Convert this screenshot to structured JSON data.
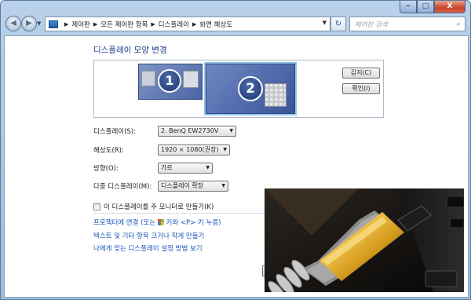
{
  "window": {
    "caption": {
      "minimize": "–",
      "maximize": "□",
      "close": "X"
    }
  },
  "nav": {
    "back_icon": "back-arrow-icon",
    "forward_icon": "forward-arrow-icon",
    "breadcrumbs": [
      "제어판",
      "모든 제어판 항목",
      "디스플레이",
      "화면 해상도"
    ],
    "refresh_icon": "refresh-icon",
    "search_placeholder": "제어판 검색"
  },
  "page": {
    "title": "디스플레이 모양 변경",
    "monitors": [
      {
        "number": "1",
        "selected": false
      },
      {
        "number": "2",
        "selected": true
      }
    ],
    "buttons": {
      "detect": "감지(C)",
      "identify": "확인(I)"
    },
    "form": {
      "display_label": "디스플레이(S):",
      "display_value": "2. BenQ EW2730V",
      "resolution_label": "해상도(R):",
      "resolution_value": "1920 × 1080(권장)",
      "orientation_label": "방향(O):",
      "orientation_value": "가로",
      "multi_label": "다중 디스플레이(M):",
      "multi_value": "디스플레이 확장"
    },
    "checkbox_label": "이 디스플레이를 주 모니터로 만들기(K)",
    "checkbox_checked": false,
    "links": {
      "projector_a": "프로젝터에 연결 (또는 ",
      "projector_b": " 키와 <P> 키 누름)",
      "text_size": "텍스트 및 기타 항목 크거나 작게 만들기",
      "settings_help": "나에게 맞는 디스플레이 설정 방법 보기"
    }
  },
  "colors": {
    "title_blue": "#1e3c8c",
    "link_blue": "#1a55b9",
    "frame": "#b9d1ea",
    "connector_gold": "#d49a1e"
  }
}
